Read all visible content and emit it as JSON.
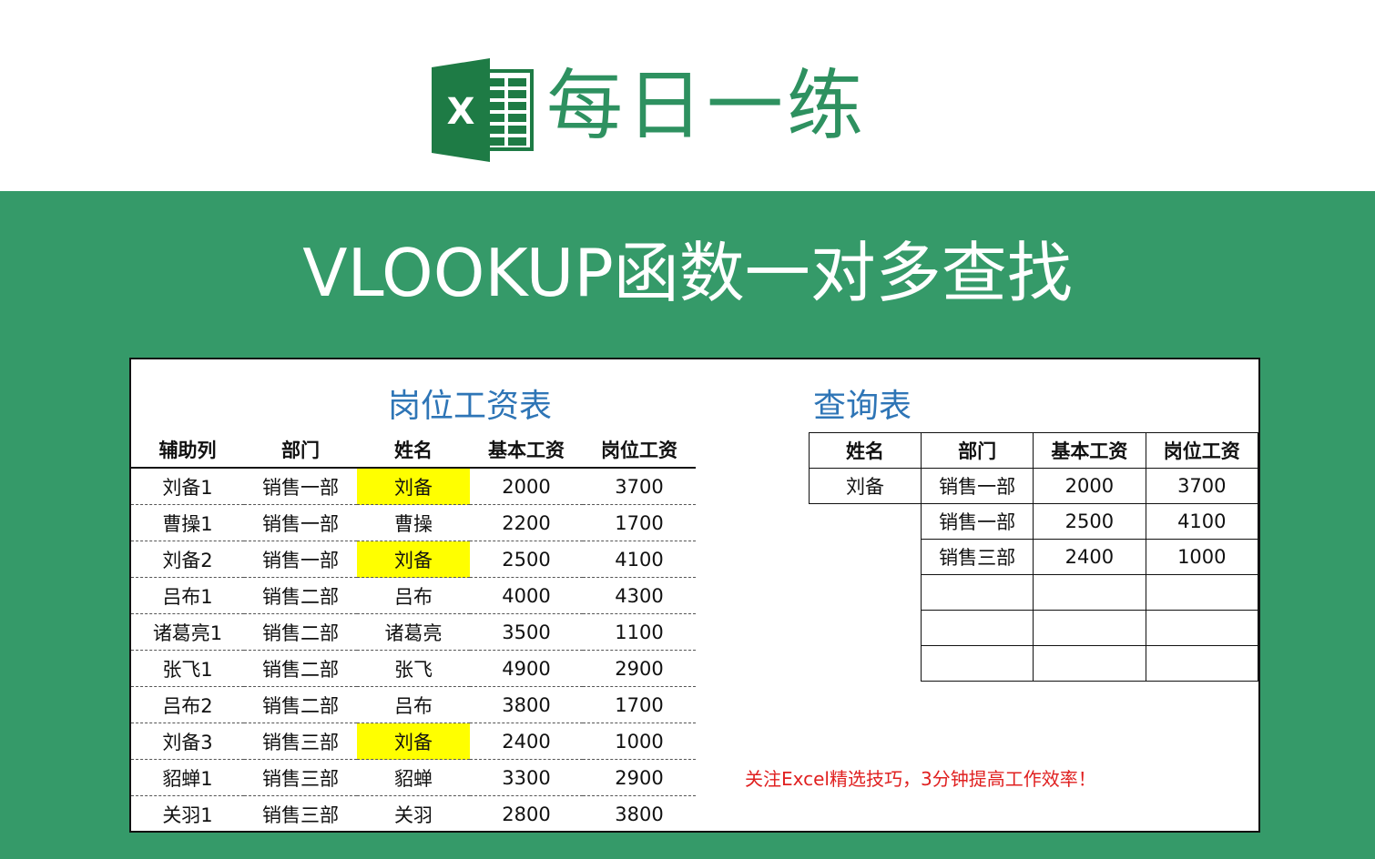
{
  "header": {
    "brand_title": "每日一练",
    "logo_letter": "X",
    "logo_icon": "excel-logo-icon",
    "brand_color": "#2e9160"
  },
  "banner": {
    "title": "VLOOKUP函数一对多查找",
    "background": "#359a69"
  },
  "salary_table": {
    "title": "岗位工资表",
    "columns": [
      "辅助列",
      "部门",
      "姓名",
      "基本工资",
      "岗位工资"
    ],
    "rows": [
      [
        "刘备1",
        "销售一部",
        "刘备",
        "2000",
        "3700"
      ],
      [
        "曹操1",
        "销售一部",
        "曹操",
        "2200",
        "1700"
      ],
      [
        "刘备2",
        "销售一部",
        "刘备",
        "2500",
        "4100"
      ],
      [
        "吕布1",
        "销售二部",
        "吕布",
        "4000",
        "4300"
      ],
      [
        "诸葛亮1",
        "销售二部",
        "诸葛亮",
        "3500",
        "1100"
      ],
      [
        "张飞1",
        "销售二部",
        "张飞",
        "4900",
        "2900"
      ],
      [
        "吕布2",
        "销售二部",
        "吕布",
        "3800",
        "1700"
      ],
      [
        "刘备3",
        "销售三部",
        "刘备",
        "2400",
        "1000"
      ],
      [
        "貂蝉1",
        "销售三部",
        "貂蝉",
        "3300",
        "2900"
      ],
      [
        "关羽1",
        "销售三部",
        "关羽",
        "2800",
        "3800"
      ]
    ],
    "highlight_color": "#ffff00"
  },
  "query_table": {
    "title": "查询表",
    "columns": [
      "姓名",
      "部门",
      "基本工资",
      "岗位工资"
    ],
    "name_value": "刘备",
    "rows": [
      [
        "销售一部",
        "2000",
        "3700"
      ],
      [
        "销售一部",
        "2500",
        "4100"
      ],
      [
        "销售三部",
        "2400",
        "1000"
      ],
      [
        "",
        "",
        ""
      ],
      [
        "",
        "",
        ""
      ],
      [
        "",
        "",
        ""
      ]
    ]
  },
  "notice": "关注Excel精选技巧，3分钟提高工作效率！",
  "colors": {
    "table_title": "#2e75b6",
    "notice": "#e02020"
  }
}
